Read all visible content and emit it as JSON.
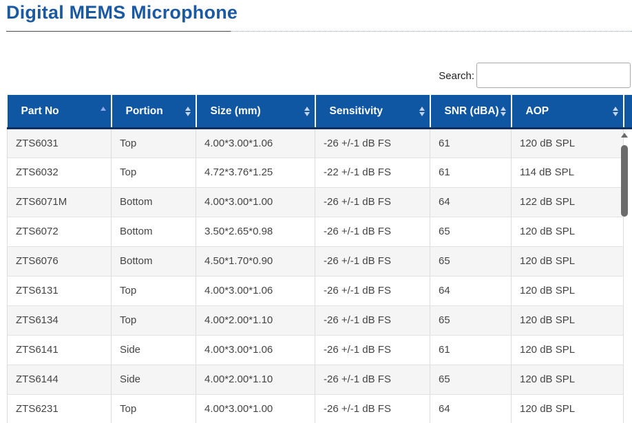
{
  "page": {
    "title": "Digital MEMS Microphone"
  },
  "search": {
    "label": "Search:",
    "value": ""
  },
  "table": {
    "columns": [
      {
        "label": "Part No",
        "sort": "asc"
      },
      {
        "label": "Portion",
        "sort": "both"
      },
      {
        "label": "Size (mm)",
        "sort": "both"
      },
      {
        "label": "Sensitivity",
        "sort": "both"
      },
      {
        "label": "SNR (dBA)",
        "sort": "both"
      },
      {
        "label": "AOP",
        "sort": "both"
      }
    ],
    "rows": [
      [
        "ZTS6031",
        "Top",
        "4.00*3.00*1.06",
        "-26 +/-1 dB FS",
        "61",
        "120 dB SPL"
      ],
      [
        "ZTS6032",
        "Top",
        "4.72*3.76*1.25",
        "-22 +/-1 dB FS",
        "61",
        "114 dB SPL"
      ],
      [
        "ZTS6071M",
        "Bottom",
        "4.00*3.00*1.00",
        "-26 +/-1 dB FS",
        "64",
        "122 dB SPL"
      ],
      [
        "ZTS6072",
        "Bottom",
        "3.50*2.65*0.98",
        "-26 +/-1 dB FS",
        "65",
        "120 dB SPL"
      ],
      [
        "ZTS6076",
        "Bottom",
        "4.50*1.70*0.90",
        "-26 +/-1 dB FS",
        "65",
        "120 dB SPL"
      ],
      [
        "ZTS6131",
        "Top",
        "4.00*3.00*1.06",
        "-26 +/-1 dB FS",
        "64",
        "120 dB SPL"
      ],
      [
        "ZTS6134",
        "Top",
        "4.00*2.00*1.10",
        "-26 +/-1 dB FS",
        "65",
        "120 dB SPL"
      ],
      [
        "ZTS6141",
        "Side",
        "4.00*3.00*1.06",
        "-26 +/-1 dB FS",
        "61",
        "120 dB SPL"
      ],
      [
        "ZTS6144",
        "Side",
        "4.00*2.00*1.10",
        "-26 +/-1 dB FS",
        "65",
        "120 dB SPL"
      ],
      [
        "ZTS6231",
        "Top",
        "4.00*3.00*1.00",
        "-26 +/-1 dB FS",
        "64",
        "120 dB SPL"
      ]
    ]
  },
  "icons": {
    "sort_asc": "sort-ascending-icon",
    "sort_both": "sort-both-icon",
    "scroll_up": "scroll-up-arrow-icon"
  },
  "colors": {
    "title": "#1b5aa3",
    "header_bg": "#0f57a3",
    "header_text": "#ffffff",
    "sort_active": "#8fa8e8",
    "sort_inactive": "#c5d3ea",
    "row_odd": "#f5f5f5",
    "row_even": "#ffffff",
    "cell_text": "#444444",
    "scroll_thumb": "#6b6b6b"
  }
}
